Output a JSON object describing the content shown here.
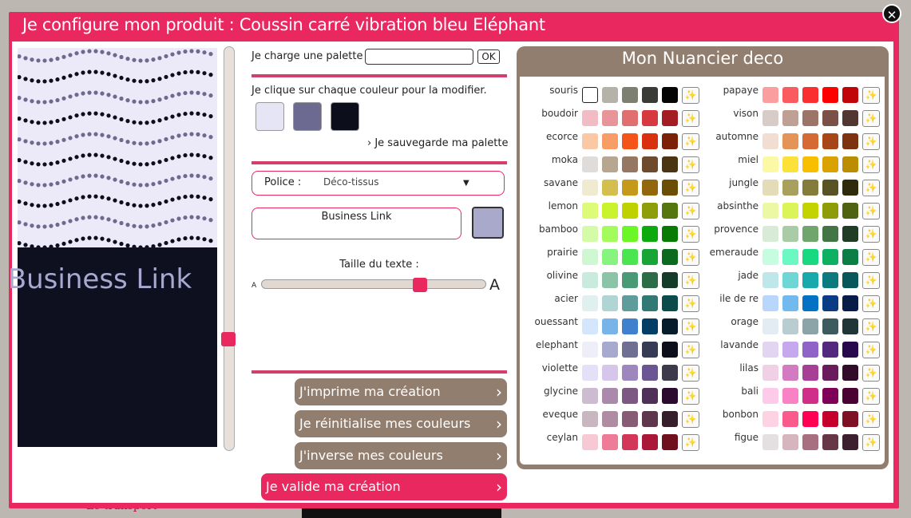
{
  "modal": {
    "title": "Je configure mon produit : Coussin carré vibration bleu Eléphant",
    "close_icon": "close-icon"
  },
  "background": {
    "bottom_text": "Le transport"
  },
  "preview": {
    "text": "Business Link",
    "pattern_color": "#eceaf8",
    "zone_color": "#0e1020",
    "text_color": "#a8a8d0"
  },
  "palette": {
    "load_label": "Je charge une palette",
    "load_value": "",
    "ok_label": "OK",
    "modify_label": "Je clique sur chaque couleur pour la modifier.",
    "colors": [
      "#e6e5f6",
      "#6c6a91",
      "#0c0e1c"
    ],
    "save_label": "Je sauvegarde ma palette"
  },
  "font": {
    "label": "Police :",
    "value": "Déco-tissus"
  },
  "text": {
    "value": "Business Link",
    "color": "#a9a9cc"
  },
  "size": {
    "label": "Taille du texte :",
    "small": "A",
    "big": "A",
    "level": 0.72
  },
  "actions": {
    "print": "J'imprime ma création",
    "reset": "Je réinitialise mes couleurs",
    "invert": "J'inverse mes couleurs",
    "validate": "Je valide ma création"
  },
  "nuancier": {
    "title": "Mon Nuancier deco",
    "left": [
      {
        "name": "souris",
        "colors": [
          "#ffffff",
          "#b5b2a9",
          "#7d7f71",
          "#3a3a36",
          "#050505"
        ]
      },
      {
        "name": "boudoir",
        "colors": [
          "#f1bcc4",
          "#e8959a",
          "#e07070",
          "#d63a40",
          "#a31d22"
        ]
      },
      {
        "name": "ecorce",
        "colors": [
          "#fbc8a6",
          "#f99d66",
          "#f45319",
          "#d9300f",
          "#7c2108"
        ]
      },
      {
        "name": "moka",
        "colors": [
          "#e0dcda",
          "#b7a791",
          "#957764",
          "#6e4b2c",
          "#4b3411"
        ]
      },
      {
        "name": "savane",
        "colors": [
          "#f0ead0",
          "#d4be4e",
          "#c59a1a",
          "#93680c",
          "#6c4d05"
        ]
      },
      {
        "name": "lemon",
        "colors": [
          "#ddfb76",
          "#c9f42d",
          "#bfd200",
          "#8d9e0a",
          "#55760f"
        ]
      },
      {
        "name": "bamboo",
        "colors": [
          "#d4fca8",
          "#a3fb5c",
          "#6bf625",
          "#0daa0e",
          "#087b04"
        ]
      },
      {
        "name": "prairie",
        "colors": [
          "#cff8d2",
          "#86f47f",
          "#4be552",
          "#17a635",
          "#0c6a1e"
        ]
      },
      {
        "name": "olivine",
        "colors": [
          "#c9ebde",
          "#8cc4a8",
          "#4b9a77",
          "#2b6c49",
          "#143c28"
        ]
      },
      {
        "name": "acier",
        "colors": [
          "#e0f0ee",
          "#afd5d4",
          "#5e9d9c",
          "#327875",
          "#0b4b4b"
        ]
      },
      {
        "name": "ouessant",
        "colors": [
          "#d4e6fb",
          "#78b4e8",
          "#3f81cd",
          "#043e67",
          "#071c2a"
        ]
      },
      {
        "name": "elephant",
        "colors": [
          "#eeeef9",
          "#a8a9cf",
          "#6e6f93",
          "#383b54",
          "#0d0f1b"
        ]
      },
      {
        "name": "violette",
        "colors": [
          "#e4e0f7",
          "#d5c6ea",
          "#9e86be",
          "#6b5592",
          "#3c3a4b"
        ]
      },
      {
        "name": "glycine",
        "colors": [
          "#cdbcd1",
          "#ab89ab",
          "#7c5883",
          "#4e3058",
          "#2b0a2d"
        ]
      },
      {
        "name": "eveque",
        "colors": [
          "#c8b6c0",
          "#b08ca3",
          "#885b75",
          "#60364f",
          "#371e2b"
        ]
      },
      {
        "name": "ceylan",
        "colors": [
          "#f7c9d5",
          "#ee7b98",
          "#d4365a",
          "#aa1739",
          "#700f1e"
        ]
      }
    ],
    "right": [
      {
        "name": "papaye",
        "colors": [
          "#fb9ea0",
          "#fa5b5e",
          "#fb2e2f",
          "#fd0000",
          "#c0040a"
        ]
      },
      {
        "name": "vison",
        "colors": [
          "#d7ccc7",
          "#bea094",
          "#9c7468",
          "#7b5047",
          "#523632"
        ]
      },
      {
        "name": "automne",
        "colors": [
          "#f1ddd1",
          "#e59458",
          "#d66a34",
          "#a94618",
          "#7d330f"
        ]
      },
      {
        "name": "miel",
        "colors": [
          "#fcf9a6",
          "#fce13a",
          "#f8bf00",
          "#daa200",
          "#ba8e00"
        ]
      },
      {
        "name": "jungle",
        "colors": [
          "#e4dcb9",
          "#a9a05e",
          "#857c3b",
          "#585225",
          "#302a0c"
        ]
      },
      {
        "name": "absinthe",
        "colors": [
          "#ecf8a4",
          "#dbf458",
          "#c2d300",
          "#8d9c08",
          "#4f6211"
        ]
      },
      {
        "name": "provence",
        "colors": [
          "#d8ebd7",
          "#a9cba5",
          "#70a56d",
          "#437644",
          "#213c25"
        ]
      },
      {
        "name": "emeraude",
        "colors": [
          "#c6fde1",
          "#6cf8c2",
          "#18d880",
          "#0eb161",
          "#0a7e44"
        ]
      },
      {
        "name": "jade",
        "colors": [
          "#bfe6e9",
          "#6fd6d6",
          "#18aaab",
          "#0d7a7d",
          "#08575b"
        ]
      },
      {
        "name": "ile de re",
        "colors": [
          "#b9d6fd",
          "#72baee",
          "#0371c4",
          "#0a3b85",
          "#071c47"
        ]
      },
      {
        "name": "orage",
        "colors": [
          "#e3ecf3",
          "#b9cdd1",
          "#8ca4a8",
          "#3d5a5e",
          "#1f3537"
        ]
      },
      {
        "name": "lavande",
        "colors": [
          "#e1d5f2",
          "#c6a8ee",
          "#8f63c7",
          "#54287e",
          "#28094e"
        ]
      },
      {
        "name": "lilas",
        "colors": [
          "#f0d0e5",
          "#d37bc1",
          "#a83f96",
          "#6a1b5c",
          "#300b2a"
        ]
      },
      {
        "name": "bali",
        "colors": [
          "#fdcbe9",
          "#f982c6",
          "#d12e8a",
          "#7e0057",
          "#4a0134"
        ]
      },
      {
        "name": "bonbon",
        "colors": [
          "#fdd3e3",
          "#fb5b8c",
          "#ff0054",
          "#c5002c",
          "#7e0f25"
        ]
      },
      {
        "name": "figue",
        "colors": [
          "#e4dfe1",
          "#d7b5bf",
          "#a86f80",
          "#673748",
          "#3c2030"
        ]
      }
    ]
  }
}
